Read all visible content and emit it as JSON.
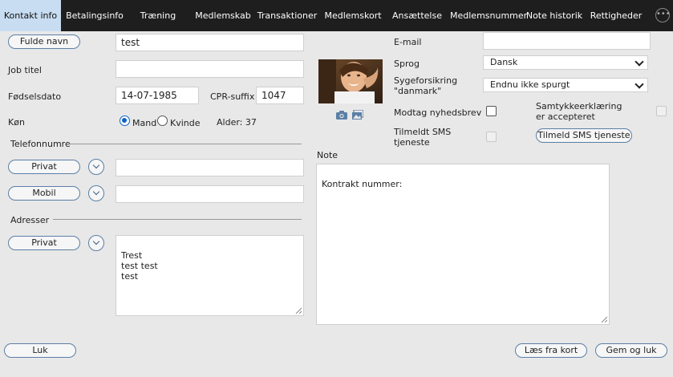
{
  "tabs": [
    {
      "label": "Kontakt info",
      "active": true
    },
    {
      "label": "Betalingsinfo",
      "active": false
    },
    {
      "label": "Træning",
      "active": false
    },
    {
      "label": "Medlemskab",
      "active": false
    },
    {
      "label": "Transaktioner",
      "active": false
    },
    {
      "label": "Medlemskort",
      "active": false
    },
    {
      "label": "Ansættelse",
      "active": false
    },
    {
      "label": "Medlemsnummer",
      "active": false
    },
    {
      "label": "Note historik",
      "active": false
    },
    {
      "label": "Rettigheder",
      "active": false
    }
  ],
  "more_icon": "ellipsis-icon",
  "form": {
    "full_name_button": "Fulde navn",
    "full_name_value": "test",
    "job_title_label": "Job titel",
    "job_title_value": "",
    "birthdate_label": "Fødselsdato",
    "birthdate_value": "14-07-1985",
    "cpr_label": "CPR-suffix",
    "cpr_value": "1047",
    "gender_label": "Køn",
    "gender_male": "Mand",
    "gender_female": "Kvinde",
    "gender_selected": "Mand",
    "age_text": "Alder: 37",
    "phones_section": "Telefonnumre",
    "phone_private_button": "Privat",
    "phone_private_value": "",
    "phone_mobile_button": "Mobil",
    "phone_mobile_value": "",
    "addresses_section": "Adresser",
    "address_private_button": "Privat",
    "address_value": "Trest\ntest test\ntest"
  },
  "photo_icons": [
    "camera-icon",
    "gallery-icon"
  ],
  "right": {
    "email_label": "E-mail",
    "email_value": "",
    "language_label": "Sprog",
    "language_value": "Dansk",
    "insurance_label": "Sygeforsikring \"danmark\"",
    "insurance_value": "Endnu ikke spurgt",
    "newsletter_label": "Modtag nyhedsbrev",
    "newsletter_checked": false,
    "consent_label": "Samtykkeerklæring er accepteret",
    "consent_checked": false,
    "sms_label": "Tilmeldt SMS tjeneste",
    "sms_checked": false,
    "sms_button": "Tilmeld SMS tjeneste",
    "note_label": "Note",
    "note_value": "Kontrakt nummer:"
  },
  "footer": {
    "close_button": "Luk",
    "read_card_button": "Læs fra kort",
    "save_close_button": "Gem og luk"
  },
  "colors": {
    "tab_bar": "#1e1e1e",
    "active_tab": "#c8ddf2",
    "panel": "#e8e8e8",
    "button_border": "#5b7fa6",
    "radio_accent": "#0b63c9"
  }
}
